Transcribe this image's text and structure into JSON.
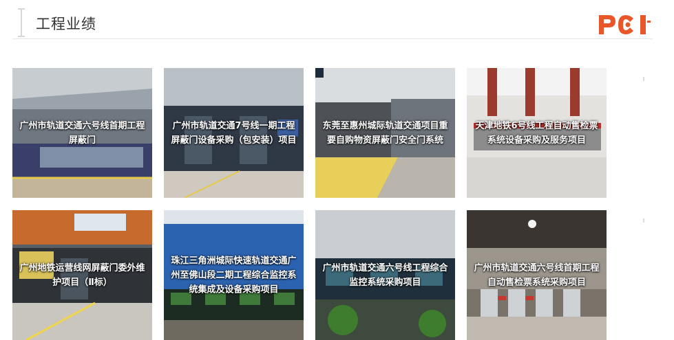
{
  "header": {
    "title": "工程业绩",
    "logo": "PCI"
  },
  "colors": {
    "accent": "#e8572a",
    "divider": "#e6e6e6"
  },
  "projects": [
    {
      "title": "广州市轨道交通六号线首期工程屏蔽门"
    },
    {
      "title": "广州市轨道交通7号线一期工程屏蔽门设备采购（包安装）项目"
    },
    {
      "title": "东莞至惠州城际轨道交通项目重要自购物资屏蔽门安全门系统"
    },
    {
      "title": "天津地铁6号线工程自动售检票系统设备采购及服务项目"
    },
    {
      "title": "广州地铁运营线网屏蔽门委外维护项目（Ⅱ标）"
    },
    {
      "title": "珠江三角洲城际快速轨道交通广州至佛山段二期工程综合监控系统集成及设备采购项目"
    },
    {
      "title": "广州市轨道交通六号线工程综合监控系统采购项目"
    },
    {
      "title": "广州市轨道交通六号线首期工程自动售检票系统采购项目"
    }
  ]
}
